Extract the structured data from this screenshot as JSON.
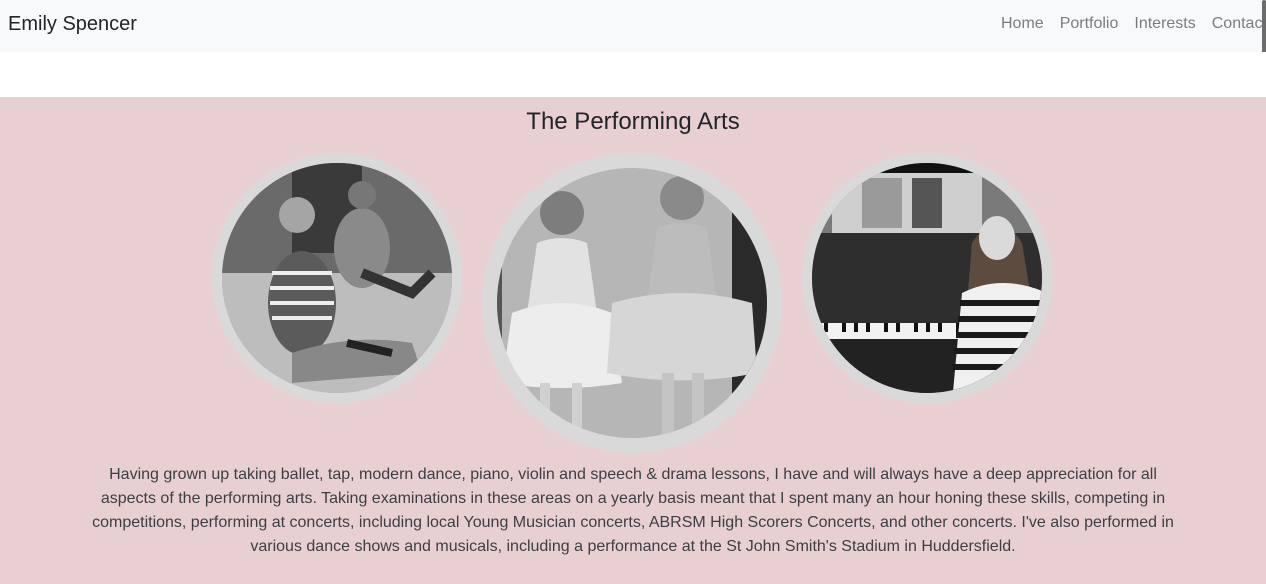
{
  "navbar": {
    "brand": "Emily Spencer",
    "links": [
      "Home",
      "Portfolio",
      "Interests",
      "Contact"
    ]
  },
  "section": {
    "title": "The Performing Arts",
    "background": "#e8cfd2",
    "photos": [
      {
        "name": "dancers-photo"
      },
      {
        "name": "ballet-girls-photo"
      },
      {
        "name": "piano-photo"
      }
    ],
    "description": "Having grown up taking ballet, tap, modern dance, piano, violin and speech & drama lessons, I have and will always have a deep appreciation for all aspects of the performing arts. Taking examinations in these areas on a yearly basis meant that I spent many an hour honing these skills, competing in competitions, performing at concerts, including local Young Musician concerts, ABRSM High Scorers Concerts, and other concerts. I've also performed in various dance shows and musicals, including a performance at the St John Smith's Stadium in Huddersfield."
  }
}
